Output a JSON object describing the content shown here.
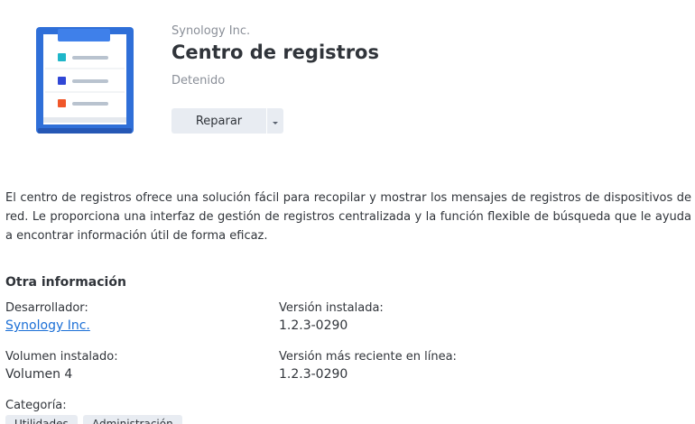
{
  "app": {
    "publisher": "Synology Inc.",
    "title": "Centro de registros",
    "status": "Detenido",
    "icon": "log-center-icon"
  },
  "actions": {
    "primary_label": "Reparar",
    "dropdown_icon": "caret-down-icon"
  },
  "description": "El centro de registros ofrece una solución fácil para recopilar y mostrar los mensajes de registros de dispositivos de red. Le proporciona una interfaz de gestión de registros centralizada y la función flexible de búsqueda que le ayuda a encontrar información útil de forma eficaz.",
  "other_info": {
    "heading": "Otra información",
    "developer_label": "Desarrollador:",
    "developer_value": "Synology Inc.",
    "installed_version_label": "Versión instalada:",
    "installed_version_value": "1.2.3-0290",
    "installed_volume_label": "Volumen instalado:",
    "installed_volume_value": "Volumen 4",
    "latest_version_label": "Versión más reciente en línea:",
    "latest_version_value": "1.2.3-0290",
    "category_label": "Categoría:",
    "categories": [
      "Utilidades",
      "Administración"
    ]
  },
  "colors": {
    "icon_blue": "#2f6fd8",
    "link": "#1b6fd6",
    "button_bg": "#e8ecf2"
  }
}
